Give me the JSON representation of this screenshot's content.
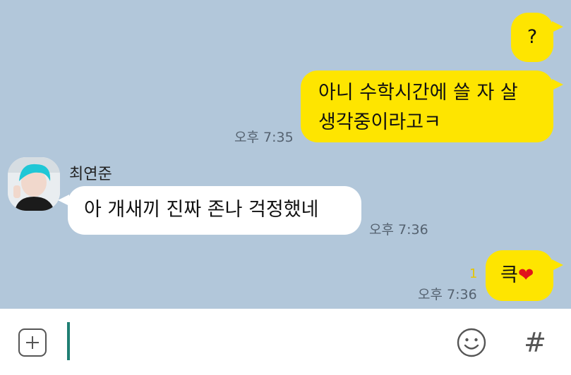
{
  "chat": {
    "messages": [
      {
        "type": "sent",
        "lines": [
          "?"
        ]
      },
      {
        "type": "sent",
        "lines": [
          "아니 수학시간에 쓸 자 살",
          "생각중이라고ㅋ"
        ],
        "time": "오후 7:35"
      },
      {
        "type": "received",
        "sender": "최연준",
        "lines": [
          "아 개새끼 진짜 존나 걱정했네"
        ],
        "time": "오후 7:36"
      },
      {
        "type": "sent",
        "lines": [
          "큭"
        ],
        "emoji": "❤",
        "unread": "1",
        "time": "오후 7:36"
      }
    ]
  },
  "input_bar": {
    "placeholder": ""
  },
  "colors": {
    "background": "#b2c7da",
    "sent_bubble": "#fee500",
    "received_bubble": "#ffffff",
    "unread": "#e7c500"
  },
  "icons": {
    "plus": "plus-square-icon",
    "emoji": "smiley-icon",
    "hash": "hash-icon"
  }
}
